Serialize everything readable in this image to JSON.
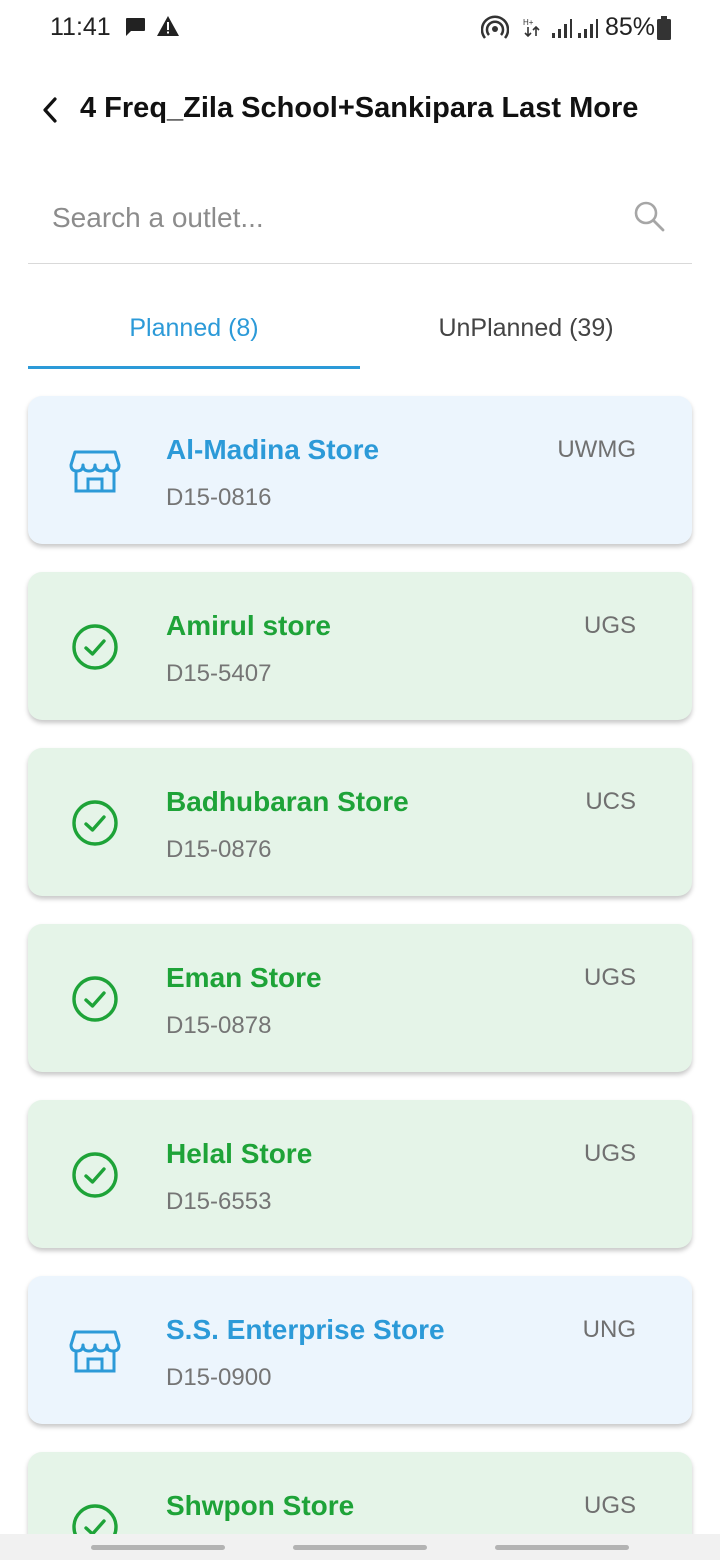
{
  "status_bar": {
    "time": "11:41",
    "battery": "85%",
    "icons": [
      "message-icon",
      "warning-icon",
      "hotspot-icon",
      "data-arrows-icon",
      "signal-icon",
      "signal-icon",
      "battery-icon"
    ]
  },
  "header": {
    "title": "4 Freq_Zila School+Sankipara Last More",
    "back_icon": "chevron-left-icon"
  },
  "search": {
    "placeholder": "Search a outlet...",
    "value": "",
    "icon": "search-icon"
  },
  "tabs": [
    {
      "label": "Planned (8)",
      "active": true
    },
    {
      "label": "UnPlanned (39)",
      "active": false
    }
  ],
  "outlets": [
    {
      "name": "Al-Madina Store",
      "code": "D15-0816",
      "type": "UWMG",
      "status": "pending",
      "icon": "store-icon"
    },
    {
      "name": "Amirul store",
      "code": "D15-5407",
      "type": "UGS",
      "status": "visited",
      "icon": "check-circle-icon"
    },
    {
      "name": "Badhubaran Store",
      "code": "D15-0876",
      "type": "UCS",
      "status": "visited",
      "icon": "check-circle-icon"
    },
    {
      "name": "Eman Store",
      "code": "D15-0878",
      "type": "UGS",
      "status": "visited",
      "icon": "check-circle-icon"
    },
    {
      "name": "Helal Store",
      "code": "D15-6553",
      "type": "UGS",
      "status": "visited",
      "icon": "check-circle-icon"
    },
    {
      "name": "S.S. Enterprise Store",
      "code": "D15-0900",
      "type": "UNG",
      "status": "pending",
      "icon": "store-icon"
    },
    {
      "name": "Shwpon Store",
      "code": "",
      "type": "UGS",
      "status": "visited",
      "icon": "check-circle-icon"
    }
  ],
  "colors": {
    "accent_blue": "#2c9ad8",
    "visited_green": "#1ea338",
    "visited_bg": "#e5f4e8",
    "pending_bg": "#ecf5fd"
  }
}
